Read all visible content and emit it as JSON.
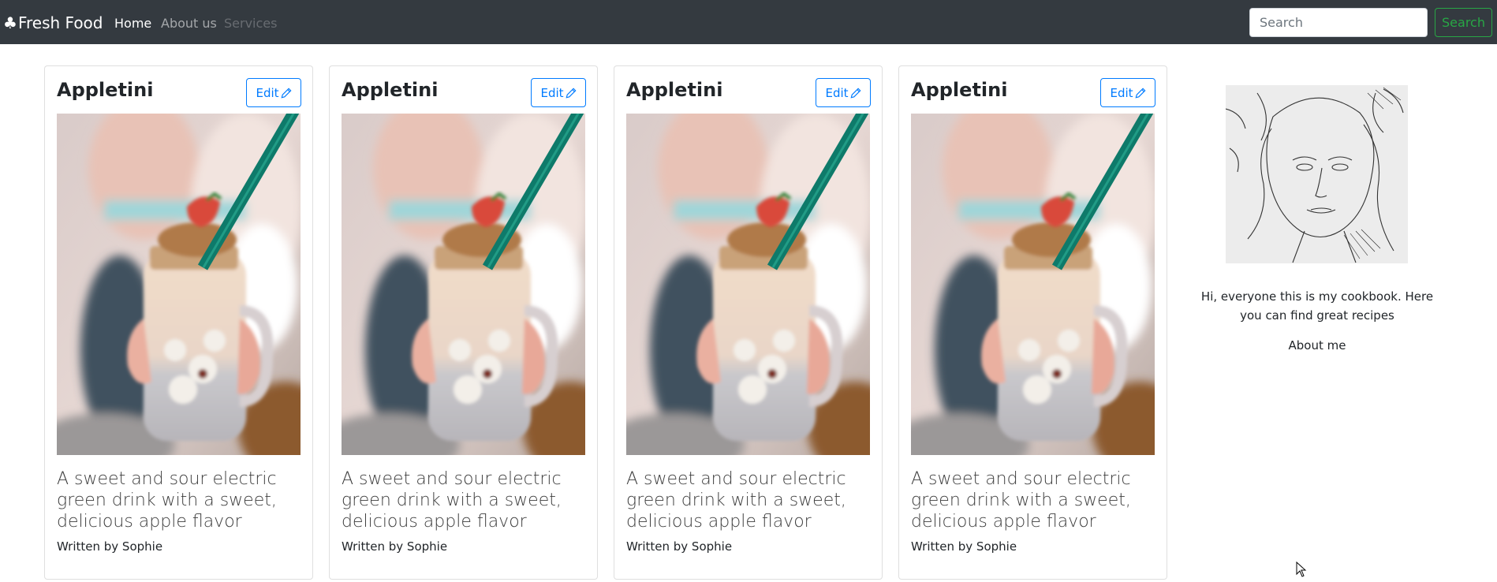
{
  "navbar": {
    "brand_icon": "♣",
    "brand": "Fresh Food",
    "links": [
      {
        "label": "Home",
        "state": "active"
      },
      {
        "label": "About us",
        "state": "normal"
      },
      {
        "label": "Services",
        "state": "disabled"
      }
    ],
    "search_placeholder": "Search",
    "search_button": "Search"
  },
  "cards": [
    {
      "title": "Appletini",
      "edit_label": "Edit",
      "image": "jar-smoothie-photo",
      "description": "A sweet and sour electric green drink with a sweet, delicious apple flavor",
      "author": "Written by Sophie"
    },
    {
      "title": "Appletini",
      "edit_label": "Edit",
      "image": "jar-smoothie-photo",
      "description": "A sweet and sour electric green drink with a sweet, delicious apple flavor",
      "author": "Written by Sophie"
    },
    {
      "title": "Appletini",
      "edit_label": "Edit",
      "image": "jar-smoothie-photo",
      "description": "A sweet and sour electric green drink with a sweet, delicious apple flavor",
      "author": "Written by Sophie"
    },
    {
      "title": "Appletini",
      "edit_label": "Edit",
      "image": "jar-smoothie-photo",
      "description": "A sweet and sour electric green drink with a sweet, delicious apple flavor",
      "author": "Written by Sophie"
    }
  ],
  "sidebar": {
    "avatar": "pencil-sketch-portrait",
    "bio": "Hi, everyone this is my cookbook. Here you can find great recipes",
    "about_link": "About me"
  },
  "colors": {
    "navbar_bg": "#343a40",
    "primary": "#007bff",
    "success": "#28a745",
    "straw": "#0e7a6a"
  }
}
